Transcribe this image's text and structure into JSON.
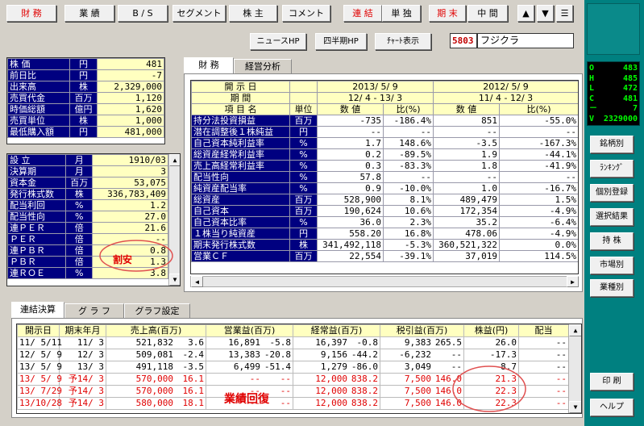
{
  "toolbar": {
    "buttons": [
      {
        "label": "財 務",
        "red": true
      },
      {
        "label": "業 績",
        "red": false
      },
      {
        "label": "B / S",
        "red": false
      },
      {
        "label": "セグメント",
        "red": false
      },
      {
        "label": "株 主",
        "red": false
      },
      {
        "label": "コメント",
        "red": false
      },
      {
        "label": "連 結",
        "red": true
      },
      {
        "label": "単 独",
        "red": false
      },
      {
        "label": "期 末",
        "red": true
      },
      {
        "label": "中 間",
        "red": false
      }
    ],
    "nav": [
      "▲",
      "▼",
      "☰"
    ]
  },
  "subbar": {
    "news": "ニュースHP",
    "quarterly": "四半期HP",
    "chart": "ﾁｬｰﾄ表示",
    "code": "5803",
    "name": "フジクラ"
  },
  "price_table": [
    {
      "label": "株 価",
      "unit": "円",
      "value": "481"
    },
    {
      "label": "前日比",
      "unit": "円",
      "value": "-7"
    },
    {
      "label": "出来高",
      "unit": "株",
      "value": "2,329,000"
    },
    {
      "label": "売買代金",
      "unit": "百万",
      "value": "1,120"
    },
    {
      "label": "時価総額",
      "unit": "億円",
      "value": "1,620"
    },
    {
      "label": "売買単位",
      "unit": "株",
      "value": "1,000"
    },
    {
      "label": "最低購入額",
      "unit": "円",
      "value": "481,000"
    }
  ],
  "info_table": [
    {
      "label": "設 立",
      "unit": "月",
      "value": "1910/03"
    },
    {
      "label": "決算期",
      "unit": "月",
      "value": "3"
    },
    {
      "label": "資本金",
      "unit": "百万",
      "value": "53,075"
    },
    {
      "label": "発行株式数",
      "unit": "株",
      "value": "336,783,409"
    },
    {
      "label": "配当利回",
      "unit": "%",
      "value": "1.2"
    },
    {
      "label": "配当性向",
      "unit": "%",
      "value": "27.0"
    },
    {
      "label": "連ＰＥＲ",
      "unit": "倍",
      "value": "21.6"
    },
    {
      "label": "ＰＥＲ",
      "unit": "倍",
      "value": "--"
    },
    {
      "label": "連ＰＢＲ",
      "unit": "倍",
      "value": "0.8"
    },
    {
      "label": "ＰＢＲ",
      "unit": "倍",
      "value": "1.3"
    },
    {
      "label": "連ＲＯＥ",
      "unit": "%",
      "value": "3.8"
    }
  ],
  "annotation_cheap": "割安",
  "annotation_recovery": "業績回復",
  "finance_tabs": [
    "財 務",
    "経営分析"
  ],
  "finance": {
    "head_date": "開 示 日",
    "head_period": "期 間",
    "head_item": "項 目 名",
    "head_unit": "単位",
    "head_num": "数 値",
    "head_ratio": "比(%)",
    "date1": "2013/ 5/ 9",
    "period1": "12/ 4 - 13/ 3",
    "date2": "2012/ 5/ 9",
    "period2": "11/ 4 - 12/ 3",
    "rows": [
      {
        "item": "持分法投資損益",
        "unit": "百万",
        "v1": "-735",
        "r1": "-186.4%",
        "v2": "851",
        "r2": "-55.0%"
      },
      {
        "item": "潜在調整後１株純益",
        "unit": "円",
        "v1": "--",
        "r1": "--",
        "v2": "--",
        "r2": "--"
      },
      {
        "item": "自己資本純利益率",
        "unit": "%",
        "v1": "1.7",
        "r1": "148.6%",
        "v2": "-3.5",
        "r2": "-167.3%"
      },
      {
        "item": "総資産経常利益率",
        "unit": "%",
        "v1": "0.2",
        "r1": "-89.5%",
        "v2": "1.9",
        "r2": "-44.1%"
      },
      {
        "item": "売上高経常利益率",
        "unit": "%",
        "v1": "0.3",
        "r1": "-83.3%",
        "v2": "1.8",
        "r2": "-41.9%"
      },
      {
        "item": "配当性向",
        "unit": "%",
        "v1": "57.8",
        "r1": "--",
        "v2": "--",
        "r2": "--"
      },
      {
        "item": "純資産配当率",
        "unit": "%",
        "v1": "0.9",
        "r1": "-10.0%",
        "v2": "1.0",
        "r2": "-16.7%"
      },
      {
        "item": "総資産",
        "unit": "百万",
        "v1": "528,900",
        "r1": "8.1%",
        "v2": "489,479",
        "r2": "1.5%"
      },
      {
        "item": "自己資本",
        "unit": "百万",
        "v1": "190,624",
        "r1": "10.6%",
        "v2": "172,354",
        "r2": "-4.9%"
      },
      {
        "item": "自己資本比率",
        "unit": "%",
        "v1": "36.0",
        "r1": "2.3%",
        "v2": "35.2",
        "r2": "-6.4%"
      },
      {
        "item": "１株当り純資産",
        "unit": "円",
        "v1": "558.20",
        "r1": "16.8%",
        "v2": "478.06",
        "r2": "-4.9%"
      },
      {
        "item": "期末発行株式数",
        "unit": "株",
        "v1": "341,492,118",
        "r1": "-5.3%",
        "v2": "360,521,322",
        "r2": "0.0%"
      },
      {
        "item": "営業ＣＦ",
        "unit": "百万",
        "v1": "22,554",
        "r1": "-39.1%",
        "v2": "37,019",
        "r2": "114.5%"
      }
    ]
  },
  "bottom_tabs": [
    "連結決算",
    "グ ラ フ",
    "グラフ設定"
  ],
  "results": {
    "headers": [
      "開示日",
      "期末年月",
      "売上高(百万)",
      "営業益(百万)",
      "経常益(百万)",
      "税引益(百万)",
      "株益(円)",
      "配当"
    ],
    "rows": [
      {
        "date": "11/ 5/11",
        "period": "11/ 3",
        "sales": "521,832",
        "sr": "3.6",
        "op": "16,891",
        "opr": "-5.8",
        "ord": "16,397",
        "ordr": "-0.8",
        "net": "9,383",
        "netr": "265.5",
        "eps": "26.0",
        "div": "--",
        "red": false
      },
      {
        "date": "12/ 5/ 9",
        "period": "12/ 3",
        "sales": "509,081",
        "sr": "-2.4",
        "op": "13,383",
        "opr": "-20.8",
        "ord": "9,156",
        "ordr": "-44.2",
        "net": "-6,232",
        "netr": "--",
        "eps": "-17.3",
        "div": "--",
        "red": false
      },
      {
        "date": "13/ 5/ 9",
        "period": "13/ 3",
        "sales": "491,118",
        "sr": "-3.5",
        "op": "6,499",
        "opr": "-51.4",
        "ord": "1,279",
        "ordr": "-86.0",
        "net": "3,049",
        "netr": "--",
        "eps": "8.7",
        "div": "--",
        "red": false
      },
      {
        "date": "13/ 5/ 9",
        "period": "予14/ 3",
        "sales": "570,000",
        "sr": "16.1",
        "op": "--",
        "opr": "--",
        "ord": "12,000",
        "ordr": "838.2",
        "net": "7,500",
        "netr": "146.0",
        "eps": "21.3",
        "div": "--",
        "red": true
      },
      {
        "date": "13/ 7/29",
        "period": "予14/ 3",
        "sales": "570,000",
        "sr": "16.1",
        "op": "--",
        "opr": "--",
        "ord": "12,000",
        "ordr": "838.2",
        "net": "7,500",
        "netr": "146.0",
        "eps": "22.3",
        "div": "--",
        "red": true
      },
      {
        "date": "13/10/28",
        "period": "予14/ 3",
        "sales": "580,000",
        "sr": "18.1",
        "op": "--",
        "opr": "--",
        "ord": "12,000",
        "ordr": "838.2",
        "net": "7,500",
        "netr": "146.0",
        "eps": "22.3",
        "div": "--",
        "red": true
      }
    ]
  },
  "quote": [
    {
      "k": "O",
      "v": "483"
    },
    {
      "k": "H",
      "v": "485"
    },
    {
      "k": "L",
      "v": "472"
    },
    {
      "k": "C",
      "v": "481"
    },
    {
      "k": "－",
      "v": "7"
    },
    {
      "k": "V",
      "v": "2329000"
    }
  ],
  "side_buttons": [
    "銘柄別",
    "ﾗﾝｷﾝｸﾞ",
    "個別登録",
    "選択結果",
    "持 株",
    "市場別",
    "業種別"
  ],
  "side_print": "印 刷",
  "side_help": "ヘルプ"
}
